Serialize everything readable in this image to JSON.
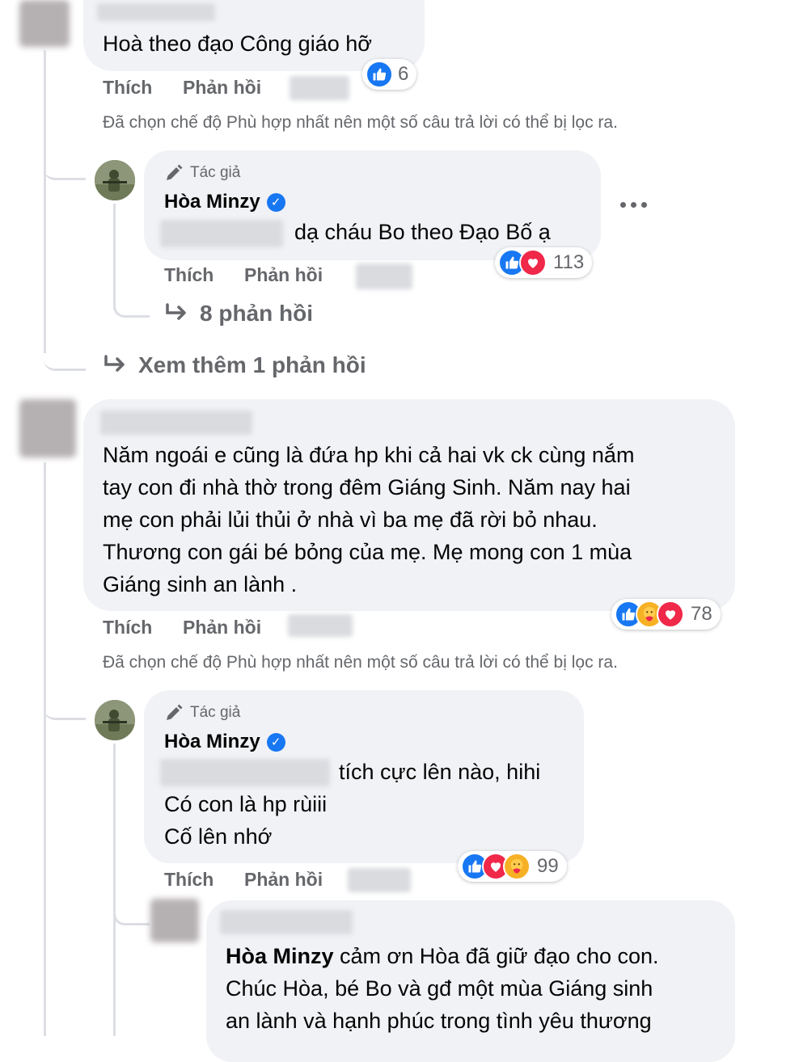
{
  "comment1": {
    "text": "Hoà theo đạo Công giáo hỡ",
    "reactions_count": "6",
    "like_label": "Thích",
    "reply_label": "Phản hồi",
    "filter_notice": "Đã chọn chế độ Phù hợp nhất nên một số câu trả lời có thể bị lọc ra."
  },
  "reply1": {
    "author_tag": "Tác giả",
    "author_name": "Hòa Minzy",
    "text": "dạ cháu Bo theo Đạo Bố ạ",
    "reactions_count": "113",
    "like_label": "Thích",
    "reply_label": "Phản hồi",
    "more_replies": "8 phản hồi"
  },
  "see_more": "Xem thêm 1 phản hồi",
  "comment2": {
    "lines": [
      "Năm ngoái e cũng là đứa hp khi cả hai vk ck cùng nắm",
      "tay con đi nhà thờ trong đêm Giáng Sinh. Năm nay hai",
      "mẹ con phải lủi thủi ở nhà vì ba mẹ đã rời bỏ nhau.",
      "Thương con gái bé bỏng của mẹ. Mẹ mong con 1 mùa",
      "Giáng sinh an lành ."
    ],
    "reactions_count": "78",
    "like_label": "Thích",
    "reply_label": "Phản hồi",
    "filter_notice": "Đã chọn chế độ Phù hợp nhất nên một số câu trả lời có thể bị lọc ra."
  },
  "reply2": {
    "author_tag": "Tác giả",
    "author_name": "Hòa Minzy",
    "lines": [
      "tích cực lên nào, hihi",
      "Có con là hp rùiii",
      "Cố lên nhớ"
    ],
    "reactions_count": "99",
    "like_label": "Thích",
    "reply_label": "Phản hồi"
  },
  "reply3": {
    "mention": "Hòa Minzy",
    "line1_rest": " cảm ơn Hòa đã giữ đạo cho con.",
    "line2": "Chúc Hòa, bé Bo và gđ một mùa Giáng sinh",
    "line3": "an lành và hạnh phúc trong tình yêu thương"
  },
  "icons": [
    "like-icon",
    "love-icon",
    "care-icon",
    "pencil-icon",
    "verified-icon",
    "reply-arrow-icon",
    "more-options-icon"
  ],
  "colors": {
    "bubble": "#f0f2f5",
    "secondary_text": "#65676b",
    "like_blue": "#1877f2",
    "love_red": "#f02849",
    "care_yellow": "#f7b125"
  }
}
